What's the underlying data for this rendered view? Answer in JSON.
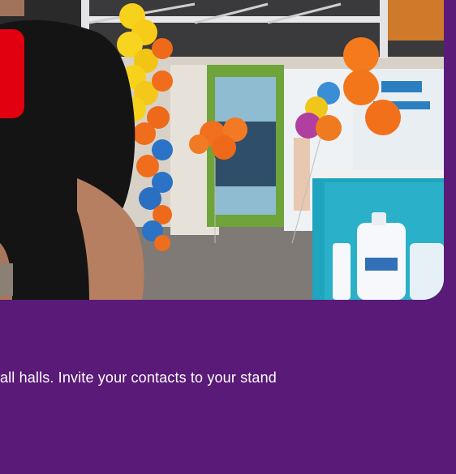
{
  "caption": {
    "text": "all halls. Invite your contacts to your stand"
  },
  "colors": {
    "background": "#5a1a78",
    "caption_text": "#ffffff",
    "badge_red": "#e0000f"
  },
  "icons": {
    "hero_image": "trade-show-stand-photo"
  }
}
